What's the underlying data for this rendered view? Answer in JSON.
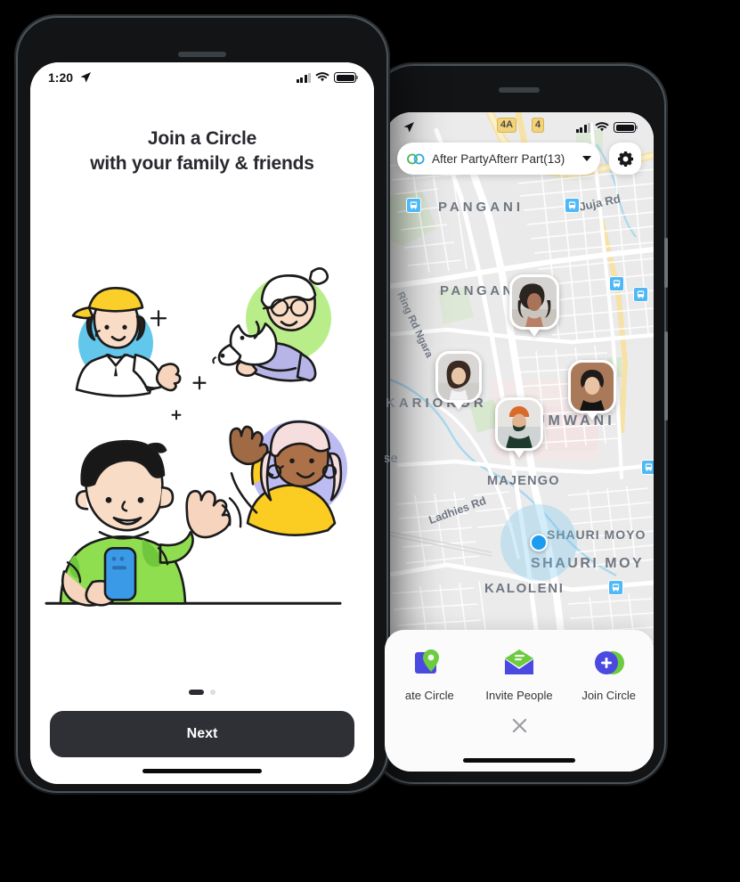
{
  "front_phone": {
    "status_bar": {
      "time": "1:20",
      "location_icon": "location-arrow-icon",
      "signal_icon": "cellular-bars-icon",
      "wifi_icon": "wifi-icon",
      "battery_icon": "battery-full-icon"
    },
    "onboarding": {
      "title_line1": "Join a Circle",
      "title_line2": "with your family & friends",
      "illustration_name": "family-and-friends-illustration",
      "pager": {
        "total": 2,
        "active_index": 0
      },
      "next_label": "Next"
    }
  },
  "back_phone": {
    "status_bar": {
      "location_icon": "location-arrow-icon",
      "signal_icon": "cellular-bars-icon",
      "wifi_icon": "wifi-icon",
      "battery_icon": "battery-full-icon"
    },
    "map_top": {
      "circle_icon": "two-interlocking-circles-icon",
      "circle_name": "After PartyAfterr Part(13)",
      "dropdown_icon": "chevron-down-icon",
      "settings_icon": "gear-icon"
    },
    "road_shields": [
      {
        "label": "4A"
      },
      {
        "label": "4"
      }
    ],
    "map_labels": [
      {
        "text": "PANGANI"
      },
      {
        "text": "Juja Rd"
      },
      {
        "text": "PANGANI"
      },
      {
        "text": "Ring Rd Ngara"
      },
      {
        "text": "KARIOKOR"
      },
      {
        "text": "UMWANI"
      },
      {
        "text": "se"
      },
      {
        "text": "MAJENGO"
      },
      {
        "text": "Ladhies Rd"
      },
      {
        "text": "SHAURI MOYO"
      },
      {
        "text": "SHAURI MOY"
      },
      {
        "text": "KALOLENI"
      }
    ],
    "members": [
      {
        "name": "member-avatar-curly-hair-woman"
      },
      {
        "name": "member-avatar-young-girl"
      },
      {
        "name": "member-avatar-dark-hair-man"
      },
      {
        "name": "member-avatar-beanie-man"
      }
    ],
    "my_location": {
      "name": "my-location-dot"
    },
    "action_sheet": {
      "actions": [
        {
          "label": "ate Circle",
          "icon": "map-pin-icon"
        },
        {
          "label": "Invite People",
          "icon": "envelope-icon"
        },
        {
          "label": "Join Circle",
          "icon": "plus-circle-icon"
        }
      ],
      "close_icon": "close-x-icon"
    }
  },
  "colors": {
    "button_dark": "#2f3036",
    "brand_green": "#6dcb3f",
    "brand_blue": "#4a4ae0",
    "accent_blue": "#1b9cf0",
    "map_bg": "#ececed",
    "map_label": "#6f7681",
    "shield_yellow": "#f2d27a"
  }
}
